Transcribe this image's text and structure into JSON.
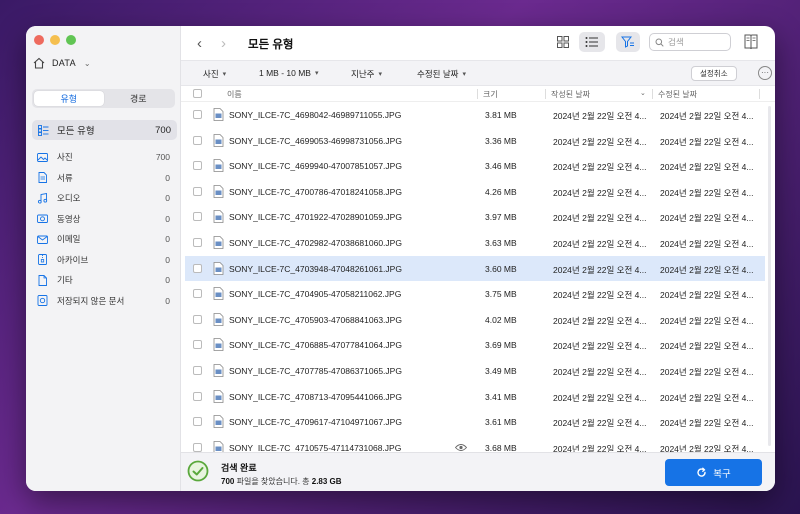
{
  "sidebar": {
    "drive_name": "DATA",
    "tabs": [
      "유형",
      "경로"
    ],
    "all_types": {
      "label": "모든 유형",
      "count": "700"
    },
    "categories": [
      {
        "label": "사진",
        "count": "700",
        "icon": "image-icon"
      },
      {
        "label": "서류",
        "count": "0",
        "icon": "document-icon"
      },
      {
        "label": "오디오",
        "count": "0",
        "icon": "music-note-icon"
      },
      {
        "label": "동영상",
        "count": "0",
        "icon": "video-camera-icon"
      },
      {
        "label": "이메일",
        "count": "0",
        "icon": "mail-icon"
      },
      {
        "label": "아카이브",
        "count": "0",
        "icon": "archive-icon"
      },
      {
        "label": "기타",
        "count": "0",
        "icon": "other-file-icon"
      },
      {
        "label": "저장되지 않은 문서",
        "count": "0",
        "icon": "unsaved-document-icon"
      }
    ]
  },
  "header": {
    "title": "모든 유형",
    "search_placeholder": "검색"
  },
  "filters": {
    "type": "사진",
    "size": "1 MB - 10 MB",
    "date": "지난주",
    "date_field": "수정된 날짜",
    "cancel_label": "설정취소"
  },
  "table": {
    "columns": [
      "이름",
      "크기",
      "작성된 날짜",
      "수정된 날짜"
    ],
    "rows": [
      {
        "name": "SONY_ILCE-7C_4698042-46989711055.JPG",
        "size": "3.81 MB",
        "created": "2024년 2월 22일 오전 4...",
        "modified": "2024년 2월 22일 오전 4..."
      },
      {
        "name": "SONY_ILCE-7C_4699053-46998731056.JPG",
        "size": "3.36 MB",
        "created": "2024년 2월 22일 오전 4...",
        "modified": "2024년 2월 22일 오전 4..."
      },
      {
        "name": "SONY_ILCE-7C_4699940-47007851057.JPG",
        "size": "3.46 MB",
        "created": "2024년 2월 22일 오전 4...",
        "modified": "2024년 2월 22일 오전 4..."
      },
      {
        "name": "SONY_ILCE-7C_4700786-47018241058.JPG",
        "size": "4.26 MB",
        "created": "2024년 2월 22일 오전 4...",
        "modified": "2024년 2월 22일 오전 4..."
      },
      {
        "name": "SONY_ILCE-7C_4701922-47028901059.JPG",
        "size": "3.97 MB",
        "created": "2024년 2월 22일 오전 4...",
        "modified": "2024년 2월 22일 오전 4..."
      },
      {
        "name": "SONY_ILCE-7C_4702982-47038681060.JPG",
        "size": "3.63 MB",
        "created": "2024년 2월 22일 오전 4...",
        "modified": "2024년 2월 22일 오전 4..."
      },
      {
        "name": "SONY_ILCE-7C_4703948-47048261061.JPG",
        "size": "3.60 MB",
        "created": "2024년 2월 22일 오전 4...",
        "modified": "2024년 2월 22일 오전 4...",
        "selected": true
      },
      {
        "name": "SONY_ILCE-7C_4704905-47058211062.JPG",
        "size": "3.75 MB",
        "created": "2024년 2월 22일 오전 4...",
        "modified": "2024년 2월 22일 오전 4..."
      },
      {
        "name": "SONY_ILCE-7C_4705903-47068841063.JPG",
        "size": "4.02 MB",
        "created": "2024년 2월 22일 오전 4...",
        "modified": "2024년 2월 22일 오전 4..."
      },
      {
        "name": "SONY_ILCE-7C_4706885-47077841064.JPG",
        "size": "3.69 MB",
        "created": "2024년 2월 22일 오전 4...",
        "modified": "2024년 2월 22일 오전 4..."
      },
      {
        "name": "SONY_ILCE-7C_4707785-47086371065.JPG",
        "size": "3.49 MB",
        "created": "2024년 2월 22일 오전 4...",
        "modified": "2024년 2월 22일 오전 4..."
      },
      {
        "name": "SONY_ILCE-7C_4708713-47095441066.JPG",
        "size": "3.41 MB",
        "created": "2024년 2월 22일 오전 4...",
        "modified": "2024년 2월 22일 오전 4..."
      },
      {
        "name": "SONY_ILCE-7C_4709617-47104971067.JPG",
        "size": "3.61 MB",
        "created": "2024년 2월 22일 오전 4...",
        "modified": "2024년 2월 22일 오전 4..."
      },
      {
        "name": "SONY_ILCE-7C_4710575-47114731068.JPG",
        "size": "3.68 MB",
        "created": "2024년 2월 22일 오전 4...",
        "modified": "2024년 2월 22일 오전 4...",
        "preview_icon": "eye-icon"
      }
    ]
  },
  "status": {
    "title": "검색 완료",
    "count": "700",
    "found_text": "파일을 찾았습니다. 총",
    "total": "2.83 GB"
  },
  "recover_label": "복구",
  "colors": {
    "accent": "#1673e6",
    "selected_row": "#dce8fa",
    "success": "#5aa83c"
  }
}
